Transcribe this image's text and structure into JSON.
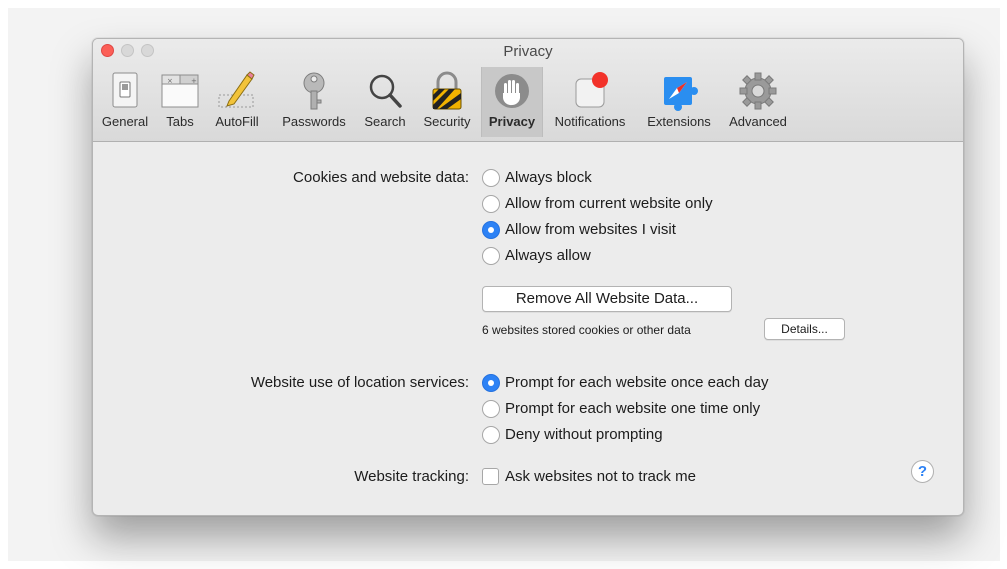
{
  "window": {
    "title": "Privacy"
  },
  "toolbar": {
    "tabs": [
      {
        "label": "General",
        "icon": "switch-icon"
      },
      {
        "label": "Tabs",
        "icon": "tabs-icon"
      },
      {
        "label": "AutoFill",
        "icon": "pencil-form-icon"
      },
      {
        "label": "Passwords",
        "icon": "key-icon"
      },
      {
        "label": "Search",
        "icon": "magnifier-icon"
      },
      {
        "label": "Security",
        "icon": "padlock-icon"
      },
      {
        "label": "Privacy",
        "icon": "hand-icon",
        "selected": true
      },
      {
        "label": "Notifications",
        "icon": "notification-badge-icon"
      },
      {
        "label": "Extensions",
        "icon": "compass-puzzle-icon"
      },
      {
        "label": "Advanced",
        "icon": "gear-icon"
      }
    ]
  },
  "cookies": {
    "label": "Cookies and website data:",
    "options": [
      "Always block",
      "Allow from current website only",
      "Allow from websites I visit",
      "Always allow"
    ],
    "selected": "Allow from websites I visit",
    "remove_button": "Remove All Website Data...",
    "stored_info": "6 websites stored cookies or other data",
    "details_button": "Details..."
  },
  "location": {
    "label": "Website use of location services:",
    "options": [
      "Prompt for each website once each day",
      "Prompt for each website one time only",
      "Deny without prompting"
    ],
    "selected": "Prompt for each website once each day"
  },
  "tracking": {
    "label": "Website tracking:",
    "checkbox_label": "Ask websites not to track me",
    "checked": false
  },
  "help": {
    "label": "?"
  },
  "colors": {
    "accent": "#2d82f5",
    "close": "#fc5f57",
    "window_bg": "#ececec"
  }
}
